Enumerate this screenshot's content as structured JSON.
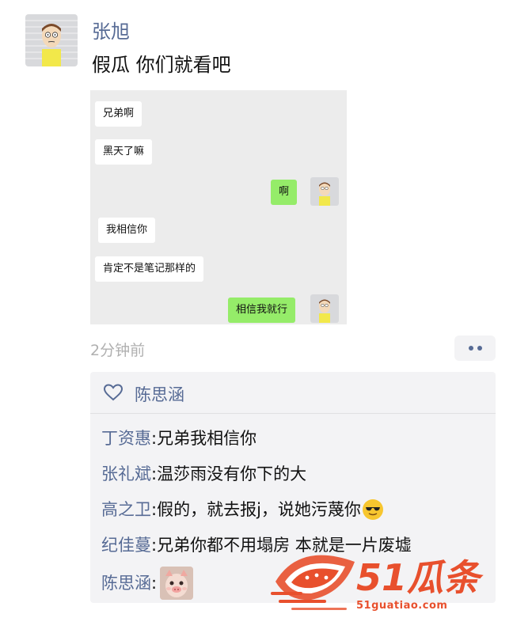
{
  "post": {
    "author": "张旭",
    "text": "假瓜 你们就看吧",
    "timestamp": "2分钟前"
  },
  "screenshot_chat": {
    "messages": [
      {
        "side": "left",
        "text": "兄弟啊"
      },
      {
        "side": "left",
        "text": "黑天了嘛"
      },
      {
        "side": "right",
        "text": "啊"
      },
      {
        "side": "left",
        "text": "我相信你"
      },
      {
        "side": "left",
        "text": "肯定不是笔记那样的"
      },
      {
        "side": "right",
        "text": "相信我就行"
      }
    ]
  },
  "likes": {
    "icon": "heart-icon",
    "names": "陈思涵"
  },
  "comments": [
    {
      "author": "丁资惠",
      "sep": ":",
      "text": " 兄弟我相信你"
    },
    {
      "author": "张礼斌",
      "sep": ":",
      "text": " 温莎雨没有你下的大"
    },
    {
      "author": "高之卫",
      "sep": ":",
      "text": " 假的，就去报j，说她污蔑你",
      "emoji": "sunglasses-emoji"
    },
    {
      "author": "纪佳蔓",
      "sep": ":",
      "text": " 兄弟你都不用塌房 本就是一片废墟"
    },
    {
      "author": "陈思涵",
      "sep": ":",
      "text": "",
      "sticker": "piglet-face-sticker"
    }
  ],
  "watermark": {
    "logo": "51瓜条",
    "url": "51guatiao.com"
  },
  "colors": {
    "link_blue": "#576b95",
    "bubble_green": "#95ec69",
    "panel_bg": "#f3f3f5",
    "watermark_orange": "#e8502d"
  }
}
